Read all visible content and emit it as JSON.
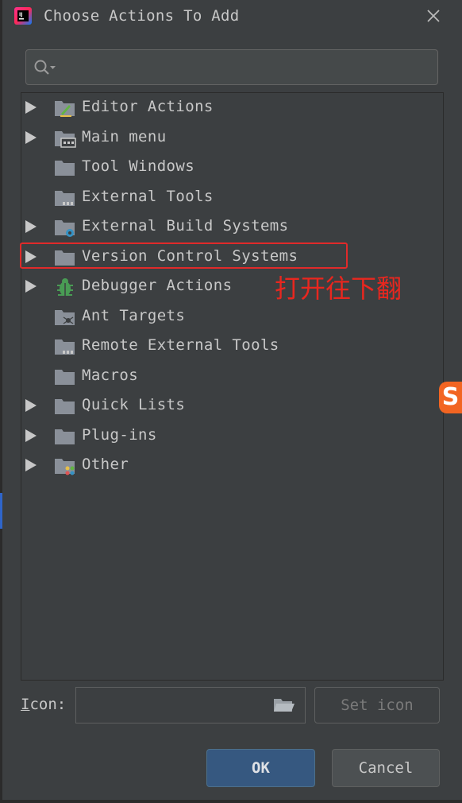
{
  "dialog": {
    "title": "Choose Actions To Add",
    "search": {
      "value": "",
      "placeholder": ""
    }
  },
  "tree": {
    "items": [
      {
        "label": "Editor Actions",
        "expandable": true,
        "icon": "folder-editor-icon"
      },
      {
        "label": "Main menu",
        "expandable": true,
        "icon": "folder-menu-icon"
      },
      {
        "label": "Tool Windows",
        "expandable": false,
        "icon": "folder-icon"
      },
      {
        "label": "External Tools",
        "expandable": false,
        "icon": "folder-external-tools-icon"
      },
      {
        "label": "External Build Systems",
        "expandable": true,
        "icon": "folder-build-gear-icon"
      },
      {
        "label": "Version Control Systems",
        "expandable": true,
        "icon": "folder-icon"
      },
      {
        "label": "Debugger Actions",
        "expandable": true,
        "icon": "bug-icon"
      },
      {
        "label": "Ant Targets",
        "expandable": false,
        "icon": "folder-ant-icon"
      },
      {
        "label": "Remote External Tools",
        "expandable": false,
        "icon": "folder-external-tools-icon"
      },
      {
        "label": "Macros",
        "expandable": false,
        "icon": "folder-icon"
      },
      {
        "label": "Quick Lists",
        "expandable": true,
        "icon": "folder-icon"
      },
      {
        "label": "Plug-ins",
        "expandable": true,
        "icon": "folder-icon"
      },
      {
        "label": "Other",
        "expandable": true,
        "icon": "folder-other-icon"
      }
    ]
  },
  "annotation": {
    "text": "打开往下翻",
    "color": "#e8271f"
  },
  "overlay": {
    "sogou_letter": "S"
  },
  "icon_row": {
    "label_mnemonic": "I",
    "label_rest": "con:",
    "value": "",
    "set_icon_label": "Set icon"
  },
  "buttons": {
    "ok_label": "OK",
    "cancel_label": "Cancel"
  },
  "colors": {
    "background": "#3c3f41",
    "accent": "#365880",
    "highlight": "#e02a2a"
  }
}
